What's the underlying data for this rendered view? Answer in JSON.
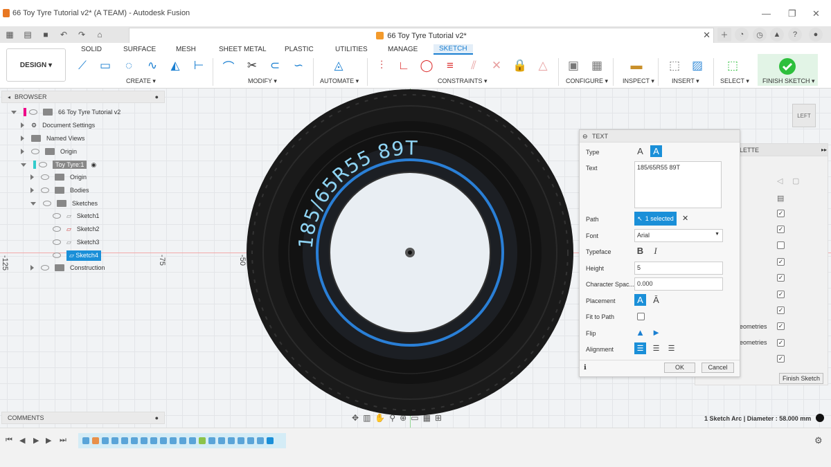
{
  "window": {
    "title": "66 Toy Tyre Tutorial v2* (A TEAM) - Autodesk Fusion",
    "doc_tab": "66 Toy Tyre Tutorial v2*"
  },
  "ribbon": {
    "workspace": "DESIGN ▾",
    "tabs": [
      "SOLID",
      "SURFACE",
      "MESH",
      "SHEET METAL",
      "PLASTIC",
      "UTILITIES",
      "MANAGE",
      "SKETCH"
    ],
    "active_tab": "SKETCH",
    "groups": {
      "create": "CREATE ▾",
      "modify": "MODIFY ▾",
      "automate": "AUTOMATE ▾",
      "constraints": "CONSTRAINTS ▾",
      "configure": "CONFIGURE ▾",
      "inspect": "INSPECT ▾",
      "insert": "INSERT ▾",
      "select": "SELECT ▾",
      "finish": "FINISH SKETCH ▾"
    }
  },
  "browser": {
    "header": "BROWSER",
    "items": [
      {
        "label": "66 Toy Tyre Tutorial v2"
      },
      {
        "label": "Document Settings"
      },
      {
        "label": "Named Views"
      },
      {
        "label": "Origin"
      },
      {
        "label": "Toy Tyre:1"
      },
      {
        "label": "Origin"
      },
      {
        "label": "Bodies"
      },
      {
        "label": "Sketches"
      },
      {
        "label": "Sketch1"
      },
      {
        "label": "Sketch2"
      },
      {
        "label": "Sketch3"
      },
      {
        "label": "Sketch4"
      },
      {
        "label": "Construction"
      }
    ]
  },
  "comments": {
    "header": "COMMENTS"
  },
  "canvas": {
    "ruler": [
      "-125",
      "-75",
      "-50"
    ],
    "sketch_text": "185/65R55 89T",
    "viewcube": "LEFT",
    "status": "1 Sketch Arc | Diameter : 58.000 mm"
  },
  "text_dialog": {
    "title": "TEXT",
    "type_label": "Type",
    "text_label": "Text",
    "text_value": "185/65R55 89T",
    "path_label": "Path",
    "path_value": "1 selected",
    "font_label": "Font",
    "font_value": "Arial",
    "typeface_label": "Typeface",
    "height_label": "Height",
    "height_value": "5",
    "spacing_label": "Character Spac...",
    "spacing_value": "0.000",
    "placement_label": "Placement",
    "fit_label": "Fit to Path",
    "flip_label": "Flip",
    "alignment_label": "Alignment",
    "ok": "OK",
    "cancel": "Cancel"
  },
  "palette": {
    "header": "LETTE",
    "row1": "eometries",
    "row2": "eometries",
    "finish": "Finish Sketch"
  },
  "colors": {
    "accent": "#1a8fd8",
    "tyre": "#151515",
    "path_circle": "#2a7fd6",
    "sketch_text": "#8fd4f4",
    "finish_green": "#2dbf3c"
  }
}
